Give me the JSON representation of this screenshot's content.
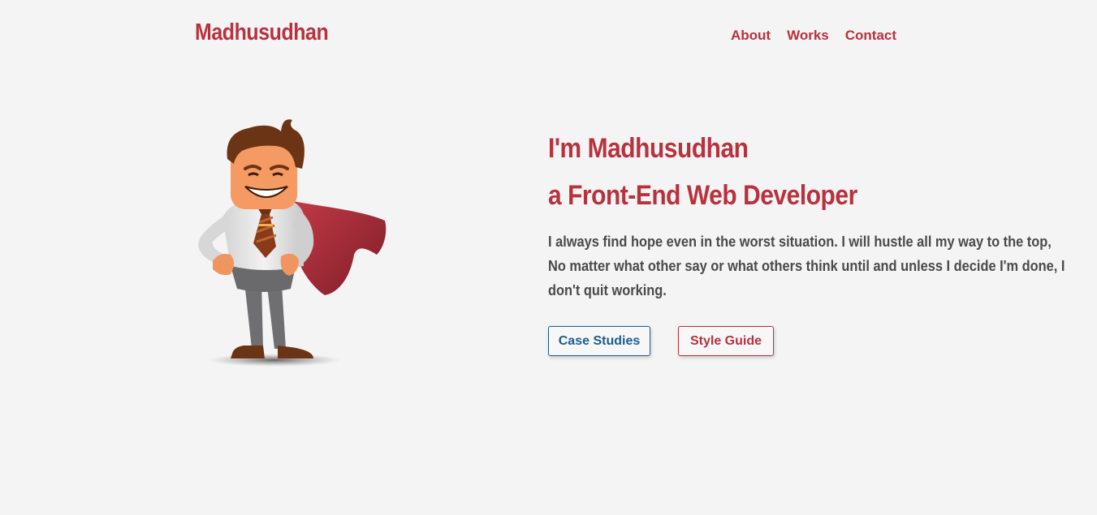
{
  "header": {
    "brand": "Madhusudhan",
    "nav": {
      "about": "About",
      "works": "Works",
      "contact": "Contact"
    }
  },
  "hero": {
    "illustration": "superhero-developer-icon",
    "title_line1": "I'm Madhusudhan",
    "title_line2": "a Front-End Web Developer",
    "description": "I always find hope even in the worst situation. I will hustle all my way to the top, No matter what other say or what others think until and unless I decide I'm done, I don't quit working.",
    "buttons": {
      "case_studies": "Case Studies",
      "style_guide": "Style Guide"
    }
  },
  "colors": {
    "accent": "#b8323e",
    "secondary": "#1c5d8e",
    "background": "#f4f4f4",
    "text": "#4a4a4a"
  }
}
